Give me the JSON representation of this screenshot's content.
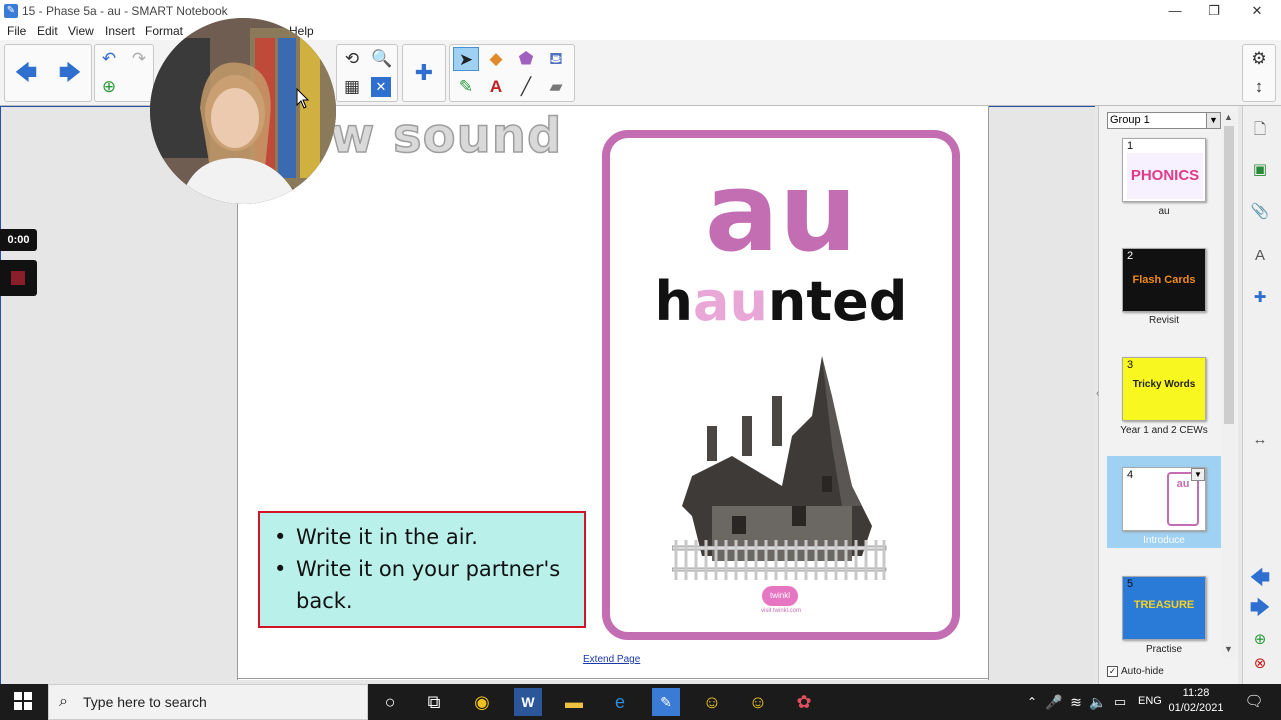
{
  "window": {
    "title": "15 - Phase 5a - au - SMART Notebook",
    "minimize": "—",
    "restore": "❐",
    "close": "✕"
  },
  "menu": {
    "items": [
      "File",
      "Edit",
      "View",
      "Insert",
      "Format",
      "Help"
    ]
  },
  "page": {
    "heading": "w sound",
    "task_items": [
      "Write it in the air.",
      "Write it on your partner's back."
    ],
    "card": {
      "big": "au",
      "word_pre": "h",
      "word_hl": "au",
      "word_post": "nted",
      "brand": "twinkl",
      "brand_url": "visit twinkl.com"
    },
    "extend_link": "Extend Page"
  },
  "recorder": {
    "time": "0:00"
  },
  "sorter": {
    "group": "Group 1",
    "slides": [
      {
        "num": "1",
        "thumb_text": "PHONICS",
        "label": "au"
      },
      {
        "num": "2",
        "thumb_text": "Flash Cards",
        "label": "Revisit"
      },
      {
        "num": "3",
        "thumb_text": "Tricky Words",
        "label": "Year 1 and 2 CEWs"
      },
      {
        "num": "4",
        "thumb_text": "au",
        "label": "Introduce"
      },
      {
        "num": "5",
        "thumb_text": "TREASURE",
        "label": "Practise"
      }
    ],
    "autohide": "Auto-hide"
  },
  "taskbar": {
    "search_placeholder": "Type here to search",
    "lang": "ENG",
    "time": "11:28",
    "date": "01/02/2021"
  },
  "colors": {
    "card_border": "#c36db3",
    "task_bg": "#b9f0ea",
    "task_border": "#d0142a",
    "selected_slide": "#9fd1f3"
  }
}
